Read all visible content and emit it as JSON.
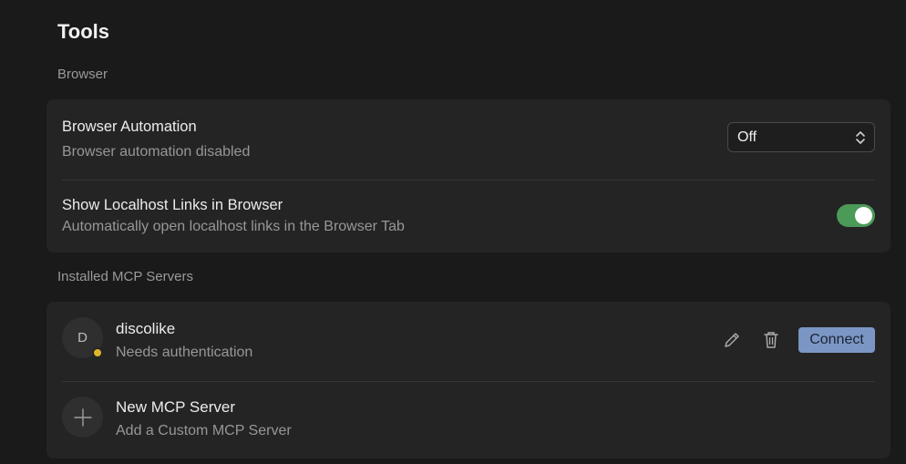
{
  "page": {
    "title": "Tools"
  },
  "browser_section": {
    "label": "Browser",
    "automation": {
      "title": "Browser Automation",
      "subtitle": "Browser automation disabled",
      "select_value": "Off"
    },
    "localhost": {
      "title": "Show Localhost Links in Browser",
      "subtitle": "Automatically open localhost links in the Browser Tab",
      "toggle_on": true
    }
  },
  "mcp_section": {
    "label": "Installed MCP Servers",
    "servers": [
      {
        "avatar_letter": "D",
        "name": "discolike",
        "status": "Needs authentication",
        "status_color": "#e0b52a",
        "connect_label": "Connect"
      }
    ],
    "new_server": {
      "title": "New MCP Server",
      "subtitle": "Add a Custom MCP Server"
    }
  },
  "colors": {
    "background": "#1a1a1a",
    "card": "#242424",
    "toggle_on": "#4c9a58",
    "connect_button": "#7b96c4"
  }
}
